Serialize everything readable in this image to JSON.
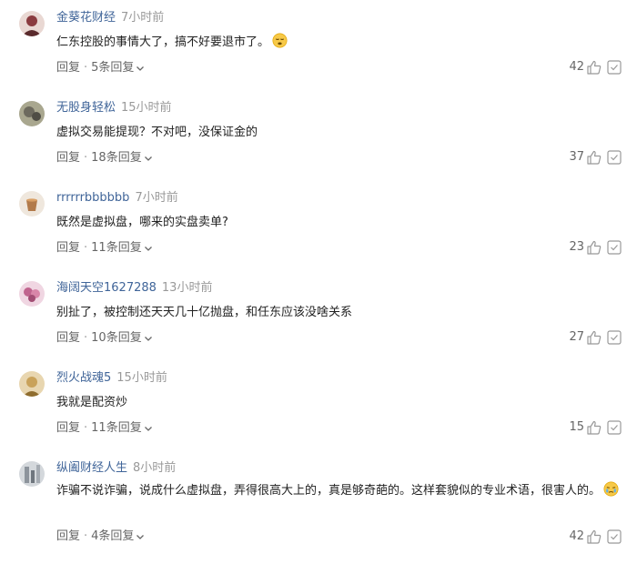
{
  "comments": [
    {
      "username": "金葵花财经",
      "time": "7小时前",
      "text": "仁东控股的事情大了，搞不好要退市了。",
      "emoji": "weary-face",
      "reply_label": "回复",
      "replies_label": "5条回复",
      "likes": "42",
      "avatar_color": "#8a3b3f"
    },
    {
      "username": "无股身轻松",
      "time": "15小时前",
      "text": "虚拟交易能提现？不对吧，没保证金的",
      "reply_label": "回复",
      "replies_label": "18条回复",
      "likes": "37",
      "avatar_color": "#6d6a5e"
    },
    {
      "username": "rrrrrrbbbbbb",
      "time": "7小时前",
      "text": "既然是虚拟盘，哪来的实盘卖单?",
      "reply_label": "回复",
      "replies_label": "11条回复",
      "likes": "23",
      "avatar_color": "#b27a4a"
    },
    {
      "username": "海阔天空1627288",
      "time": "13小时前",
      "text": "别扯了，被控制还天天几十亿抛盘，和任东应该没啥关系",
      "reply_label": "回复",
      "replies_label": "10条回复",
      "likes": "27",
      "avatar_color": "#c0648e"
    },
    {
      "username": "烈火战魂5",
      "time": "15小时前",
      "text": "我就是配资炒",
      "reply_label": "回复",
      "replies_label": "11条回复",
      "likes": "15",
      "avatar_color": "#c9a25a"
    },
    {
      "username": "纵阖财经人生",
      "time": "8小时前",
      "text": "诈骗不说诈骗，说成什么虚拟盘，弄得很高大上的，真是够奇葩的。这样套貌似的专业术语，很害人的。",
      "emoji": "crying-face",
      "reply_label": "回复",
      "replies_label": "4条回复",
      "likes": "42",
      "avatar_color": "#8d949c"
    }
  ]
}
